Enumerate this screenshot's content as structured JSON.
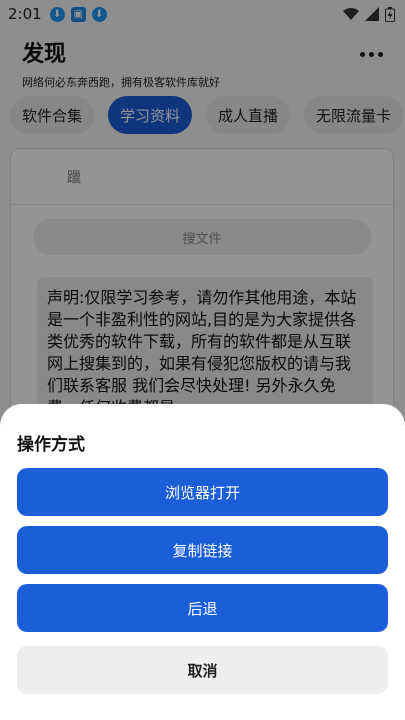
{
  "status_bar": {
    "time": "2:01",
    "notification_icons": [
      "download-icon",
      "app-icon",
      "download-icon"
    ]
  },
  "header": {
    "title": "发现",
    "subtitle": "网络何必东奔西跑，拥有极客软件库就好"
  },
  "tabs": [
    {
      "label": "软件合集",
      "active": false
    },
    {
      "label": "学习资料",
      "active": true
    },
    {
      "label": "成人直播",
      "active": false
    },
    {
      "label": "无限流量卡",
      "active": false
    }
  ],
  "card": {
    "row_text": "躐",
    "search_button": "搜文件",
    "notice": "声明:仅限学习参考，请勿作其他用途，本站是一个非盈利性的网站,目的是为大家提供各类优秀的软件下载，所有的软件都是从互联网上搜集到的，如果有侵犯您版权的请与我们联系客服 我们会尽快处理! 另外永久免费，任何收费都是"
  },
  "sheet": {
    "title": "操作方式",
    "buttons": {
      "open_browser": "浏览器打开",
      "copy_link": "复制链接",
      "back": "后退",
      "cancel": "取消"
    }
  },
  "colors": {
    "accent": "#1a5ed8",
    "overlay": "rgba(0,0,0,0.42)"
  }
}
